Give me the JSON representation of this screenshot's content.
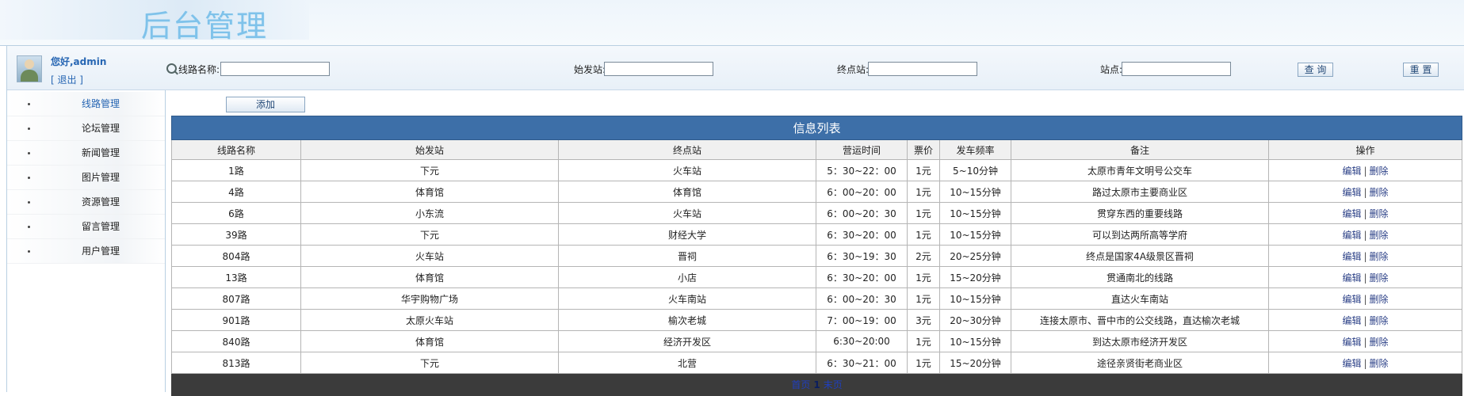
{
  "header": {
    "logo_text": "后台管理"
  },
  "user": {
    "greeting": "您好,admin",
    "logout": "[ 退出 ]"
  },
  "menu": [
    {
      "label": "线路管理",
      "active": true
    },
    {
      "label": "论坛管理"
    },
    {
      "label": "新闻管理"
    },
    {
      "label": "图片管理"
    },
    {
      "label": "资源管理"
    },
    {
      "label": "留言管理"
    },
    {
      "label": "用户管理"
    }
  ],
  "search": {
    "route_label": "线路名称:",
    "start_label": "始发站:",
    "end_label": "终点站:",
    "stop_label": "站点:",
    "route_value": "",
    "start_value": "",
    "end_value": "",
    "stop_value": "",
    "query_button": "查 询",
    "reset_button": "重 置"
  },
  "add_button": "添加",
  "table": {
    "caption": "信息列表",
    "columns": [
      "线路名称",
      "始发站",
      "终点站",
      "营运时间",
      "票价",
      "发车频率",
      "备注",
      "操作"
    ],
    "edit_label": "编辑",
    "delete_label": "删除",
    "rows": [
      [
        "1路",
        "下元",
        "火车站",
        "5：30~22：00",
        "1元",
        "5~10分钟",
        "太原市青年文明号公交车"
      ],
      [
        "4路",
        "体育馆",
        "体育馆",
        "6：00~20：00",
        "1元",
        "10~15分钟",
        "路过太原市主要商业区"
      ],
      [
        "6路",
        "小东流",
        "火车站",
        "6：00~20：30",
        "1元",
        "10~15分钟",
        "贯穿东西的重要线路"
      ],
      [
        "39路",
        "下元",
        "财经大学",
        "6：30~20：00",
        "1元",
        "10~15分钟",
        "可以到达两所高等学府"
      ],
      [
        "804路",
        "火车站",
        "晋祠",
        "6：30~19：30",
        "2元",
        "20~25分钟",
        "终点是国家4A级景区晋祠"
      ],
      [
        "13路",
        "体育馆",
        "小店",
        "6：30~20：00",
        "1元",
        "15~20分钟",
        "贯通南北的线路"
      ],
      [
        "807路",
        "华宇购物广场",
        "火车南站",
        "6：00~20：30",
        "1元",
        "10~15分钟",
        "直达火车南站"
      ],
      [
        "901路",
        "太原火车站",
        "榆次老城",
        "7：00~19：00",
        "3元",
        "20~30分钟",
        "连接太原市、晋中市的公交线路，直达榆次老城"
      ],
      [
        "840路",
        "体育馆",
        "经济开发区",
        "6:30~20:00",
        "1元",
        "10~15分钟",
        "到达太原市经济开发区"
      ],
      [
        "813路",
        "下元",
        "北营",
        "6：30~21：00",
        "1元",
        "15~20分钟",
        "途径亲贤街老商业区"
      ]
    ]
  },
  "pager": {
    "first": "首页",
    "current": "1",
    "last": "末页"
  }
}
